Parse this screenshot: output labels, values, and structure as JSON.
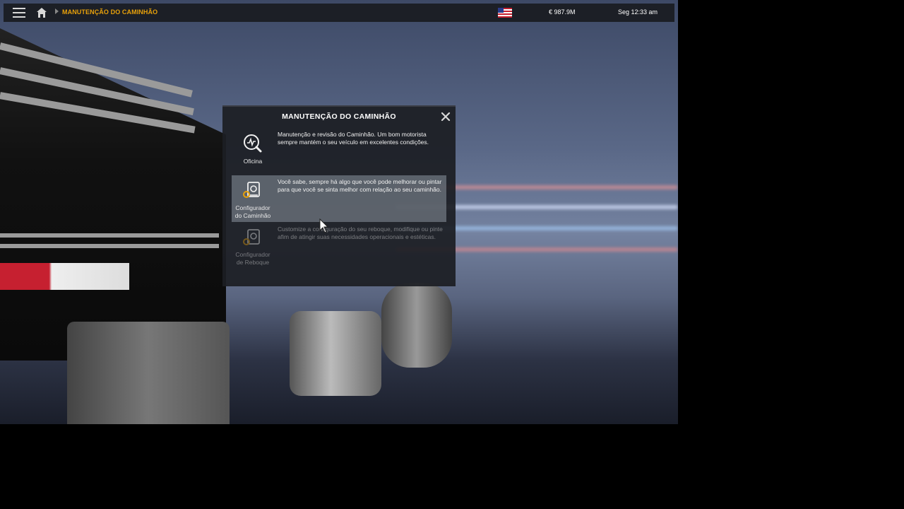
{
  "topbar": {
    "menu_icon": "hamburger-menu-icon",
    "home_icon": "home-icon",
    "breadcrumb": "MANUTENÇÃO DO CAMINHÃO",
    "money": "€ 987.9M",
    "time": "Seg 12:33 am",
    "flag_icon": "usa-flag-icon"
  },
  "modal": {
    "title": "MANUTENÇÃO DO CAMINHÃO",
    "close_icon": "close-icon",
    "options": [
      {
        "label": "Oficina",
        "icon": "wrench-gauge-icon",
        "description": "Manutenção e revisão do Caminhão. Um bom motorista sempre mantém o seu veículo em excelentes condições."
      },
      {
        "label": "Configurador do Caminhão",
        "icon": "truck-config-icon",
        "description": "Você sabe, sempre há algo que você pode melhorar ou pintar para que você se sinta melhor com relação ao seu caminhão."
      },
      {
        "label": "Configurador de Reboque",
        "icon": "trailer-config-icon",
        "description": "Customize a configuração do seu reboque, modifique ou pinte afim de atingir suas necessidades operacionais e estéticas."
      }
    ]
  },
  "colors": {
    "accent": "#e8a10a",
    "topbar_bg": "#1c1f26",
    "modal_bg": "#1c1e23"
  }
}
